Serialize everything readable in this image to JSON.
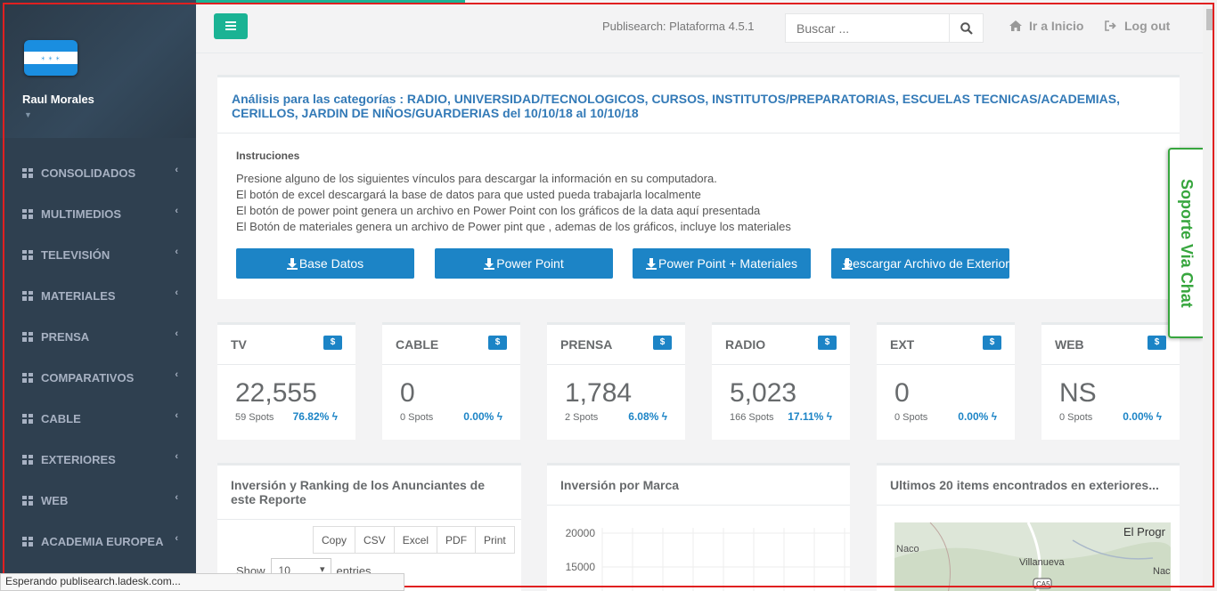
{
  "sidebar": {
    "user_name": "Raul Morales",
    "items": [
      {
        "label": "CONSOLIDADOS"
      },
      {
        "label": "MULTIMEDIOS"
      },
      {
        "label": "TELEVISIÓN"
      },
      {
        "label": "MATERIALES"
      },
      {
        "label": "PRENSA"
      },
      {
        "label": "COMPARATIVOS"
      },
      {
        "label": "CABLE"
      },
      {
        "label": "EXTERIORES"
      },
      {
        "label": "WEB"
      },
      {
        "label": "ACADEMIA EUROPEA"
      }
    ]
  },
  "topbar": {
    "platform": "Publisearch: Plataforma 4.5.1",
    "search_placeholder": "Buscar ...",
    "home_label": "Ir a Inicio",
    "logout_label": "Log out"
  },
  "analysis": {
    "title": "Análisis para las categorías : RADIO, UNIVERSIDAD/TECNOLOGICOS, CURSOS, INSTITUTOS/PREPARATORIAS, ESCUELAS TECNICAS/ACADEMIAS, CERILLOS, JARDIN DE NIÑOS/GUARDERIAS del 10/10/18 al 10/10/18",
    "instructions_heading": "Instruciones",
    "instructions": [
      "Presione alguno de los siguientes vínculos para descargar la información en su computadora.",
      "El botón de excel descargará la base de datos para que usted pueda trabajarla localmente",
      "El botón de power point genera un archivo en Power Point con los gráficos de la data aquí presentada",
      "El Botón de materiales genera un archivo de Power pint que , ademas de los gráficos, incluye los materiales"
    ],
    "buttons": [
      "Base Datos",
      "Power Point",
      "Power Point + Materiales",
      "Descargar Archivo de Exteriores"
    ]
  },
  "stats": [
    {
      "label": "TV",
      "badge": "$",
      "value": "22,555",
      "spots": "59 Spots",
      "pct": "76.82%"
    },
    {
      "label": "CABLE",
      "badge": "$",
      "value": "0",
      "spots": "0 Spots",
      "pct": "0.00%"
    },
    {
      "label": "PRENSA",
      "badge": "$",
      "value": "1,784",
      "spots": "2 Spots",
      "pct": "6.08%"
    },
    {
      "label": "RADIO",
      "badge": "$",
      "value": "5,023",
      "spots": "166 Spots",
      "pct": "17.11%"
    },
    {
      "label": "EXT",
      "badge": "$",
      "value": "0",
      "spots": "0 Spots",
      "pct": "0.00%"
    },
    {
      "label": "WEB",
      "badge": "$",
      "value": "NS",
      "spots": "0 Spots",
      "pct": "0.00%"
    }
  ],
  "panels": {
    "ranking_title": "Inversión y Ranking de los Anunciantes de este Reporte",
    "table_buttons": [
      "Copy",
      "CSV",
      "Excel",
      "PDF",
      "Print"
    ],
    "show_label": "Show",
    "entries_value": "10",
    "entries_label": "entries",
    "marca_title": "Inversión por Marca",
    "ext_title": "Ultimos 20 items encontrados en exteriores...",
    "map_labels": [
      "Naco",
      "El Progr",
      "Villanueva",
      "Nac",
      "CA5"
    ]
  },
  "chart_data": {
    "type": "bar",
    "title": "Inversión por Marca",
    "visible_ticks": [
      20000,
      15000
    ],
    "categories": [],
    "values": []
  },
  "support_label": "Soporte Via Chat",
  "status_text": "Esperando publisearch.ladesk.com...",
  "colors": {
    "sidebar": "#2f4050",
    "accent_green": "#1ab394",
    "blue": "#1c84c6",
    "support_green": "#37a63e"
  }
}
